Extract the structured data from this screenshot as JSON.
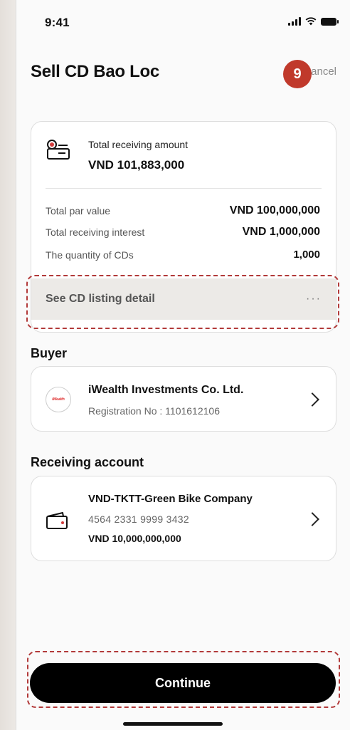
{
  "status_bar": {
    "time": "9:41"
  },
  "header": {
    "title": "Sell CD Bao Loc",
    "cancel_label": "Cancel",
    "step_badge": "9"
  },
  "summary": {
    "receiving_label": "Total receiving amount",
    "receiving_amount": "VND 101,883,000",
    "rows": [
      {
        "label": "Total par value",
        "value": "VND 100,000,000"
      },
      {
        "label": "Total receiving interest",
        "value": "VND 1,000,000"
      },
      {
        "label": "The quantity of CDs",
        "value": "1,000"
      }
    ],
    "listing_link": "See CD listing detail",
    "listing_more": "···"
  },
  "buyer": {
    "section_title": "Buyer",
    "name": "iWealth Investments Co. Ltd.",
    "registration": "Registration No : 1101612106",
    "logo_text": "iWealth"
  },
  "receiving_account": {
    "section_title": "Receiving account",
    "name": "VND-TKTT-Green Bike Company",
    "number": "4564 2331 9999 3432",
    "balance": "VND 10,000,000,000"
  },
  "footer": {
    "continue_label": "Continue"
  },
  "colors": {
    "accent_badge": "#c0392b",
    "highlight_dash": "#b23a3a",
    "primary_button": "#000000"
  }
}
